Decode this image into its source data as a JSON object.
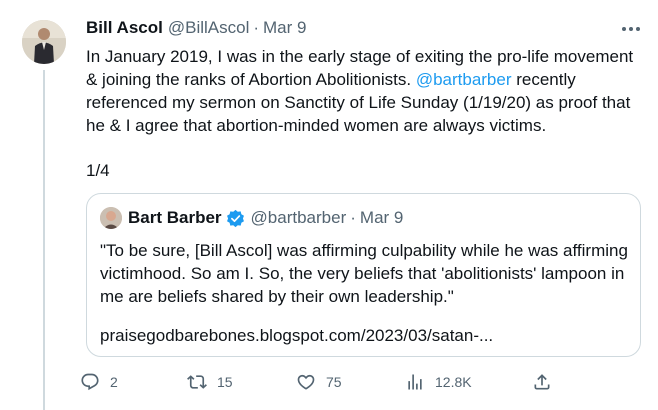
{
  "tweet": {
    "author_name": "Bill Ascol",
    "author_handle": "@BillAscol",
    "separator": "·",
    "date": "Mar 9",
    "text_part1": "In January 2019, I was in the early stage of exiting the pro-life movement & joining the ranks of Abortion Abolitionists. ",
    "mention": "@bartbarber",
    "text_part2": " recently referenced my sermon on Sanctity of Life Sunday (1/19/20) as proof that he & I agree that abortion-minded women are always victims.",
    "thread_count": "1/4"
  },
  "quote": {
    "author_name": "Bart Barber",
    "author_handle": "@bartbarber",
    "separator": "·",
    "date": "Mar 9",
    "text": "\"To be sure, [Bill Ascol] was affirming culpability while he was affirming victimhood. So am I. So, the very beliefs that 'abolitionists' lampoon in me are beliefs shared by their own leadership.\"",
    "link": "praisegodbarebones.blogspot.com/2023/03/satan-..."
  },
  "actions": {
    "replies": "2",
    "retweets": "15",
    "likes": "75",
    "views": "12.8K"
  },
  "colors": {
    "text": "#0f1419",
    "secondary": "#536471",
    "link": "#1d9bf0",
    "border": "#cfd9de",
    "verified": "#1d9bf0"
  }
}
